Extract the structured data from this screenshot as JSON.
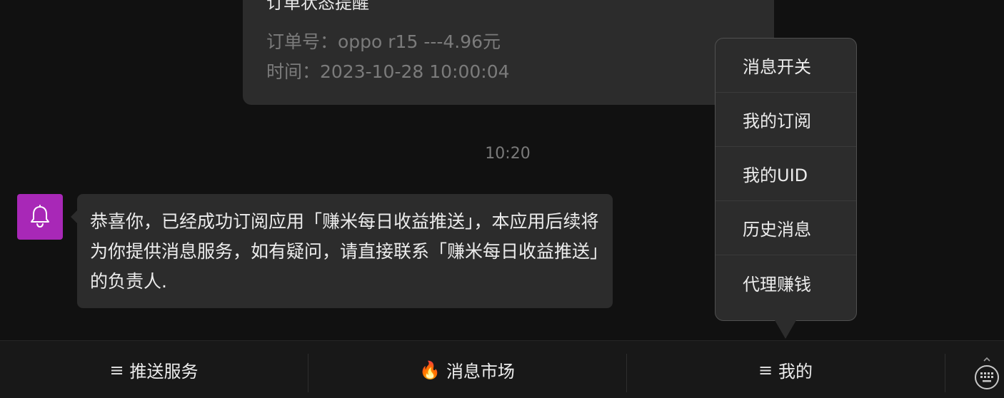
{
  "order_card": {
    "title": "订单状态提醒",
    "order_line": "订单号：oppo r15 ---4.96元",
    "time_line": "时间：2023-10-28 10:00:04"
  },
  "timestamp": "10:20",
  "message": {
    "avatar_icon": "bell-icon",
    "avatar_color": "#a828b7",
    "text": "恭喜你，已经成功订阅应用「赚米每日收益推送」，本应用后续将为你提供消息服务，如有疑问，请直接联系「赚米每日收益推送」的负责人."
  },
  "popup_menu": {
    "items": [
      {
        "label": "消息开关"
      },
      {
        "label": "我的订阅"
      },
      {
        "label": "我的UID"
      },
      {
        "label": "历史消息"
      },
      {
        "label": "代理赚钱"
      }
    ]
  },
  "bottom_bar": {
    "tabs": [
      {
        "prefix": "≡",
        "label": "推送服务"
      },
      {
        "prefix": "🔥",
        "label": "消息市场"
      },
      {
        "prefix": "≡",
        "label": "我的"
      }
    ],
    "keyboard_icon": "keyboard-icon"
  }
}
